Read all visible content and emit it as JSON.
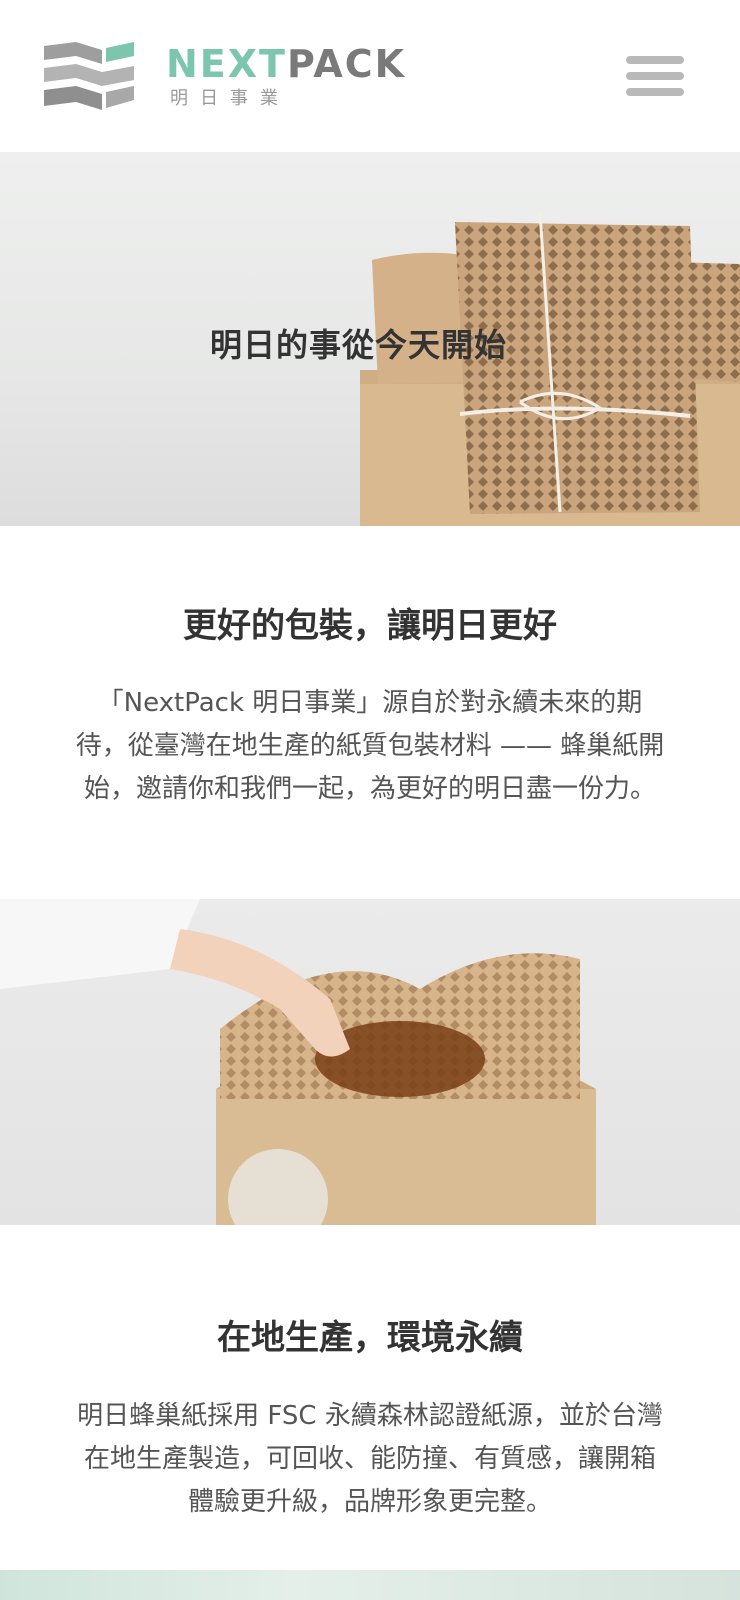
{
  "header": {
    "logo_word_a": "NEXT",
    "logo_word_b": "PACK",
    "logo_sub": "明日事業",
    "brand_green": "#7cc6ad",
    "brand_gray": "#7a7a7a",
    "menu_icon": "hamburger-icon"
  },
  "hero": {
    "title": "明日的事從今天開始"
  },
  "intro": {
    "title": "更好的包裝，讓明日更好",
    "text": "「NextPack 明日事業」源自於對永續未來的期待，從臺灣在地生產的紙質包裝材料 —— 蜂巢紙開始，邀請你和我們一起，為更好的明日盡一份力。"
  },
  "local": {
    "title": "在地生產，環境永續",
    "text": "明日蜂巢紙採用 FSC 永續森林認證紙源，並於台灣在地生產製造，可回收、能防撞、有質感，讓開箱體驗更升級，品牌形象更完整。"
  }
}
